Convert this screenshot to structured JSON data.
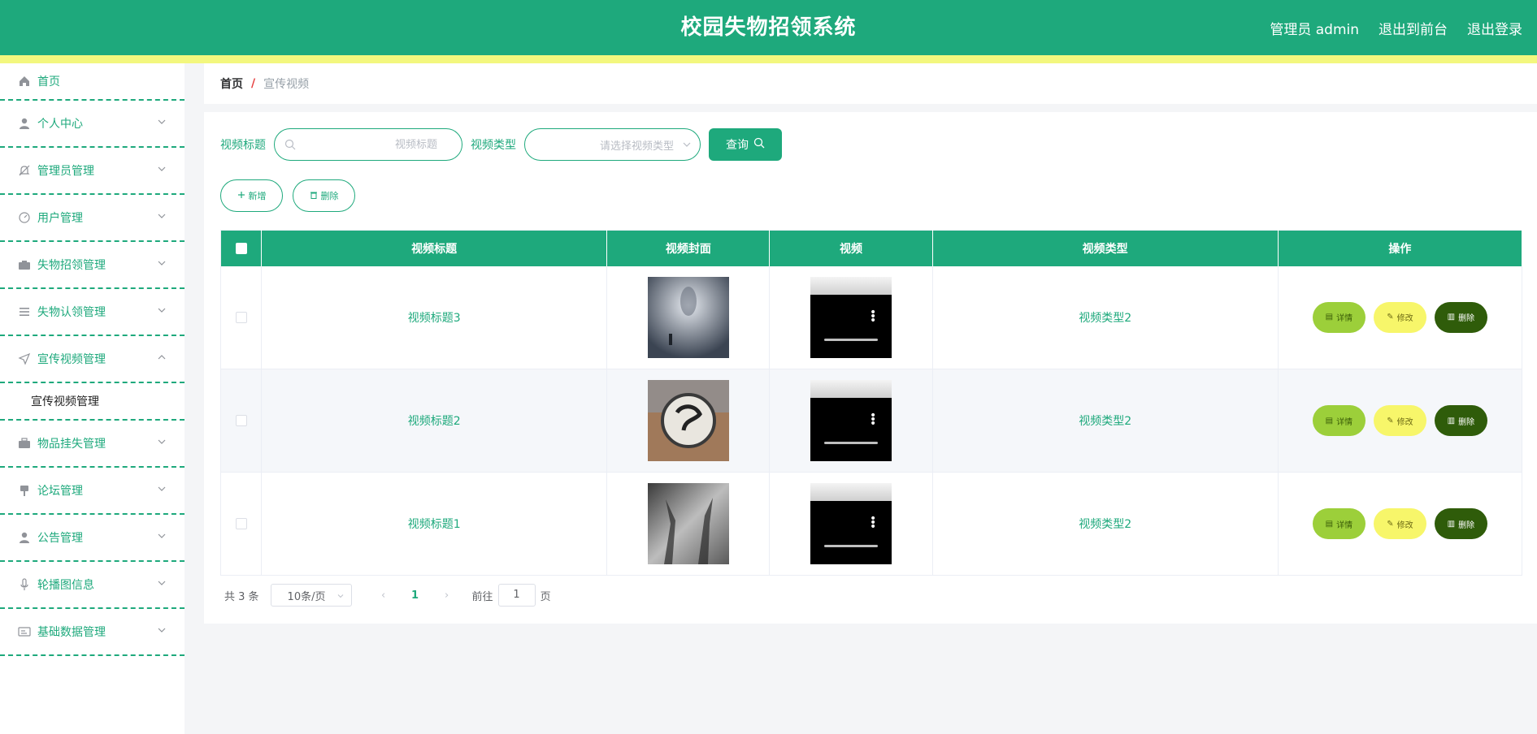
{
  "header": {
    "title": "校园失物招领系统",
    "user_label": "管理员 admin",
    "to_front": "退出到前台",
    "logout": "退出登录"
  },
  "sidebar": {
    "items": [
      {
        "label": "首页",
        "icon": "home-icon"
      },
      {
        "label": "个人中心",
        "icon": "user-icon"
      },
      {
        "label": "管理员管理",
        "icon": "bell-off-icon"
      },
      {
        "label": "用户管理",
        "icon": "gauge-icon"
      },
      {
        "label": "失物招领管理",
        "icon": "camera-icon"
      },
      {
        "label": "失物认领管理",
        "icon": "menu-icon"
      },
      {
        "label": "宣传视频管理",
        "icon": "send-icon",
        "submenu": "宣传视频管理"
      },
      {
        "label": "物品挂失管理",
        "icon": "briefcase-icon"
      },
      {
        "label": "论坛管理",
        "icon": "brush-icon"
      },
      {
        "label": "公告管理",
        "icon": "user-icon"
      },
      {
        "label": "轮播图信息",
        "icon": "microphone-icon"
      },
      {
        "label": "基础数据管理",
        "icon": "id-card-icon"
      }
    ]
  },
  "breadcrumb": {
    "home": "首页",
    "sep": "/",
    "current": "宣传视频"
  },
  "search": {
    "title_label": "视频标题",
    "title_placeholder": "视频标题",
    "type_label": "视频类型",
    "type_placeholder": "请选择视频类型",
    "query_label": "查询"
  },
  "actions": {
    "add_label": "新增",
    "delete_label": "删除"
  },
  "table": {
    "columns": [
      "视频标题",
      "视频封面",
      "视频",
      "视频类型",
      "操作"
    ],
    "rows": [
      {
        "title": "视频标题3",
        "type": "视频类型2"
      },
      {
        "title": "视频标题2",
        "type": "视频类型2"
      },
      {
        "title": "视频标题1",
        "type": "视频类型2"
      }
    ],
    "op_labels": {
      "detail": "详情",
      "edit": "修改",
      "delete": "删除"
    }
  },
  "pagination": {
    "total": "共 3 条",
    "page_size": "10条/页",
    "current_page": "1",
    "goto_label": "前往",
    "goto_value": "1",
    "page_unit": "页"
  },
  "colors": {
    "primary": "#1ea97c",
    "stripe": "#f3f77e",
    "detail": "#9ccf3a",
    "edit": "#f7f66a",
    "delete": "#2f5c0a"
  }
}
